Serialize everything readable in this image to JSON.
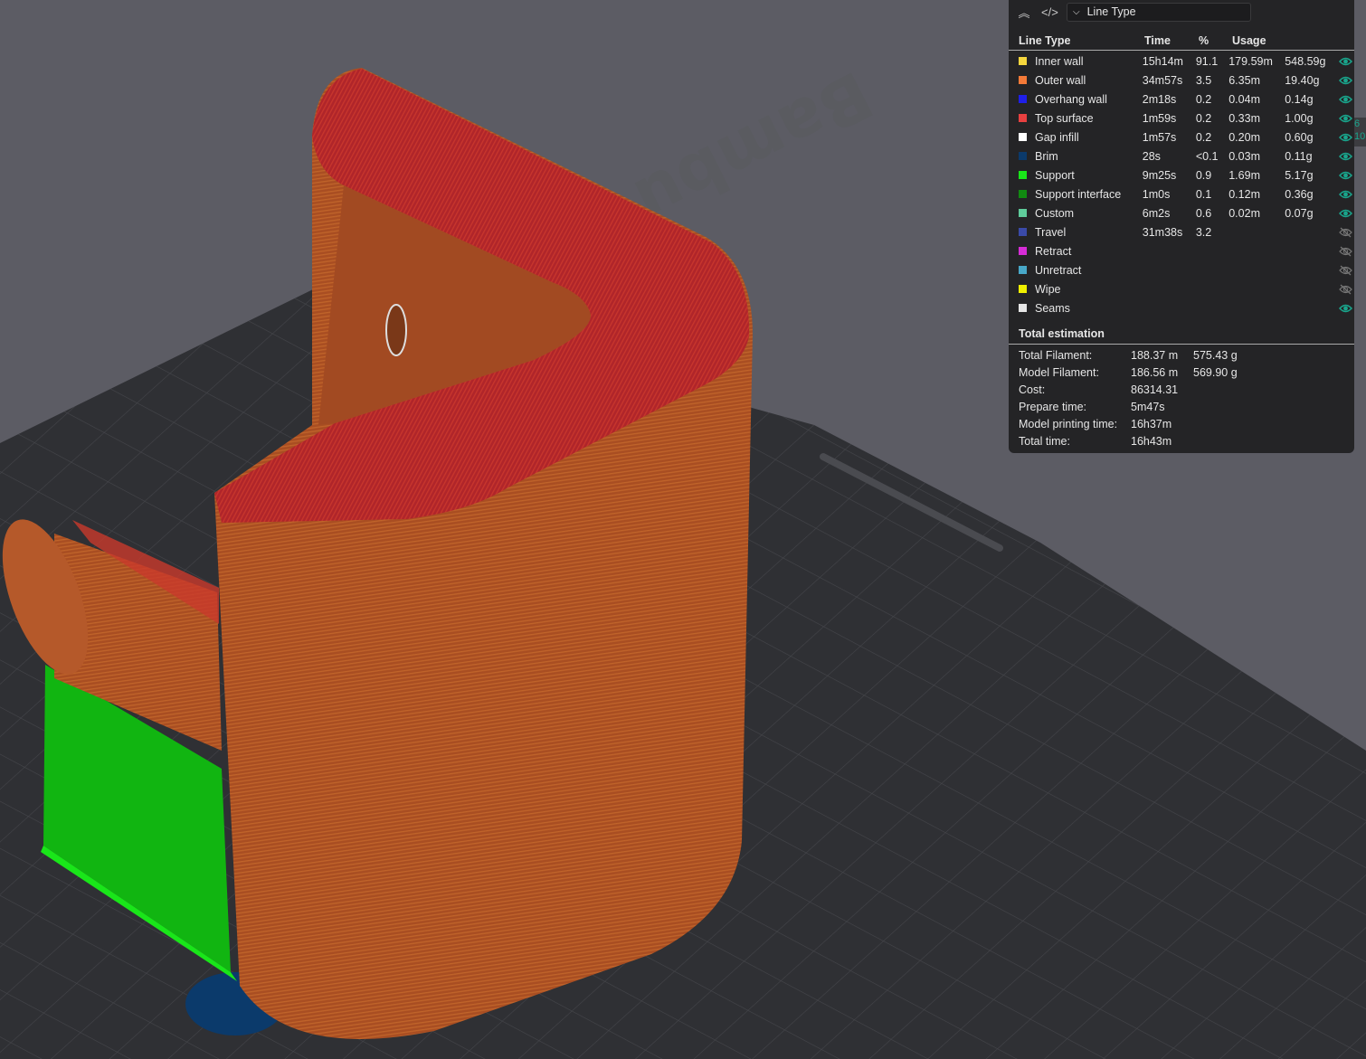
{
  "plate": {
    "logo_text": "Bambu Textured"
  },
  "legend": {
    "view_selector": "Line Type",
    "headers": {
      "type": "Line Type",
      "time": "Time",
      "percent": "%",
      "usage": "Usage"
    },
    "rows": [
      {
        "name": "Inner wall",
        "color": "#f5d63d",
        "time": "15h14m",
        "percent": "91.1",
        "length": "179.59m",
        "weight": "548.59g",
        "visible": true
      },
      {
        "name": "Outer wall",
        "color": "#f47a38",
        "time": "34m57s",
        "percent": "3.5",
        "length": "6.35m",
        "weight": "19.40g",
        "visible": true
      },
      {
        "name": "Overhang wall",
        "color": "#1f1fe8",
        "time": "2m18s",
        "percent": "0.2",
        "length": "0.04m",
        "weight": "0.14g",
        "visible": true
      },
      {
        "name": "Top surface",
        "color": "#e84040",
        "time": "1m59s",
        "percent": "0.2",
        "length": "0.33m",
        "weight": "1.00g",
        "visible": true
      },
      {
        "name": "Gap infill",
        "color": "#ffffff",
        "time": "1m57s",
        "percent": "0.2",
        "length": "0.20m",
        "weight": "0.60g",
        "visible": true
      },
      {
        "name": "Brim",
        "color": "#0b3a6b",
        "time": "28s",
        "percent": "<0.1",
        "length": "0.03m",
        "weight": "0.11g",
        "visible": true
      },
      {
        "name": "Support",
        "color": "#19e619",
        "time": "9m25s",
        "percent": "0.9",
        "length": "1.69m",
        "weight": "5.17g",
        "visible": true
      },
      {
        "name": "Support interface",
        "color": "#118a11",
        "time": "1m0s",
        "percent": "0.1",
        "length": "0.12m",
        "weight": "0.36g",
        "visible": true
      },
      {
        "name": "Custom",
        "color": "#5fcc9b",
        "time": "6m2s",
        "percent": "0.6",
        "length": "0.02m",
        "weight": "0.07g",
        "visible": true
      },
      {
        "name": "Travel",
        "color": "#3a4aa8",
        "time": "31m38s",
        "percent": "3.2",
        "length": "",
        "weight": "",
        "visible": false
      },
      {
        "name": "Retract",
        "color": "#d62cd6",
        "time": "",
        "percent": "",
        "length": "",
        "weight": "",
        "visible": false
      },
      {
        "name": "Unretract",
        "color": "#48a8c8",
        "time": "",
        "percent": "",
        "length": "",
        "weight": "",
        "visible": false
      },
      {
        "name": "Wipe",
        "color": "#f0f000",
        "time": "",
        "percent": "",
        "length": "",
        "weight": "",
        "visible": false
      },
      {
        "name": "Seams",
        "color": "#e6e6e6",
        "time": "",
        "percent": "",
        "length": "",
        "weight": "",
        "visible": true
      }
    ],
    "total": {
      "title": "Total estimation",
      "rows": [
        {
          "label": "Total Filament:",
          "v1": "188.37 m",
          "v2": "575.43 g"
        },
        {
          "label": "Model Filament:",
          "v1": "186.56 m",
          "v2": "569.90 g"
        },
        {
          "label": "Cost:",
          "v1": "86314.31",
          "v2": ""
        },
        {
          "label": "Prepare time:",
          "v1": "5m47s",
          "v2": ""
        },
        {
          "label": "Model printing time:",
          "v1": "16h37m",
          "v2": ""
        },
        {
          "label": "Total time:",
          "v1": "16h43m",
          "v2": ""
        }
      ]
    }
  },
  "slider": {
    "top": "6",
    "bottom": "10"
  },
  "colors": {
    "accent": "#19a58c",
    "eye_off": "#777777"
  }
}
